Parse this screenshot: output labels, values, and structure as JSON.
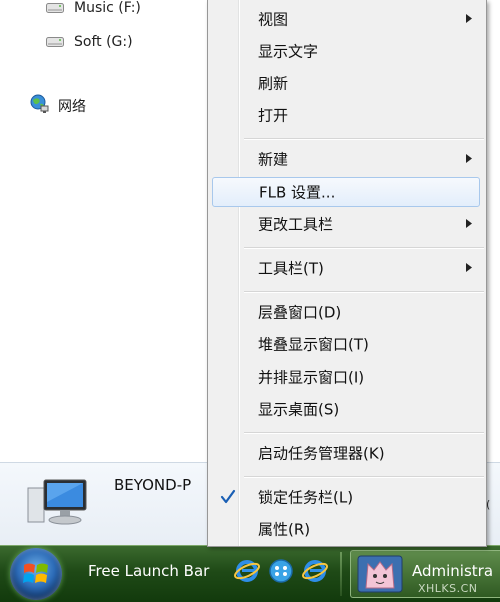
{
  "explorer": {
    "drives": [
      {
        "label": "Music (F:)"
      },
      {
        "label": "Soft (G:)"
      }
    ],
    "network_label": "网络",
    "computer_name": "BEYOND-P",
    "computer_name_tail": "("
  },
  "taskbar": {
    "launch_label": "Free Launch Bar",
    "task_label": "Administra",
    "watermark": "XHLKS.CN"
  },
  "context_menu": {
    "items": [
      {
        "label": "视图",
        "submenu": true
      },
      {
        "label": "显示文字"
      },
      {
        "label": "刷新"
      },
      {
        "label": "打开"
      },
      {
        "label": "新建",
        "submenu": true
      },
      {
        "label": "FLB 设置...",
        "highlighted": true
      },
      {
        "label": "更改工具栏",
        "submenu": true
      },
      {
        "label": "工具栏(T)",
        "submenu": true
      },
      {
        "label": "层叠窗口(D)"
      },
      {
        "label": "堆叠显示窗口(T)"
      },
      {
        "label": "并排显示窗口(I)"
      },
      {
        "label": "显示桌面(S)"
      },
      {
        "label": "启动任务管理器(K)"
      },
      {
        "label": "锁定任务栏(L)",
        "checked": true
      },
      {
        "label": "属性(R)"
      }
    ]
  },
  "colors": {
    "menu_bg": "#f0f0f0",
    "hover_border": "#a8c8ec",
    "taskbar": "#1f4a17",
    "check": "#1a5fb4"
  }
}
